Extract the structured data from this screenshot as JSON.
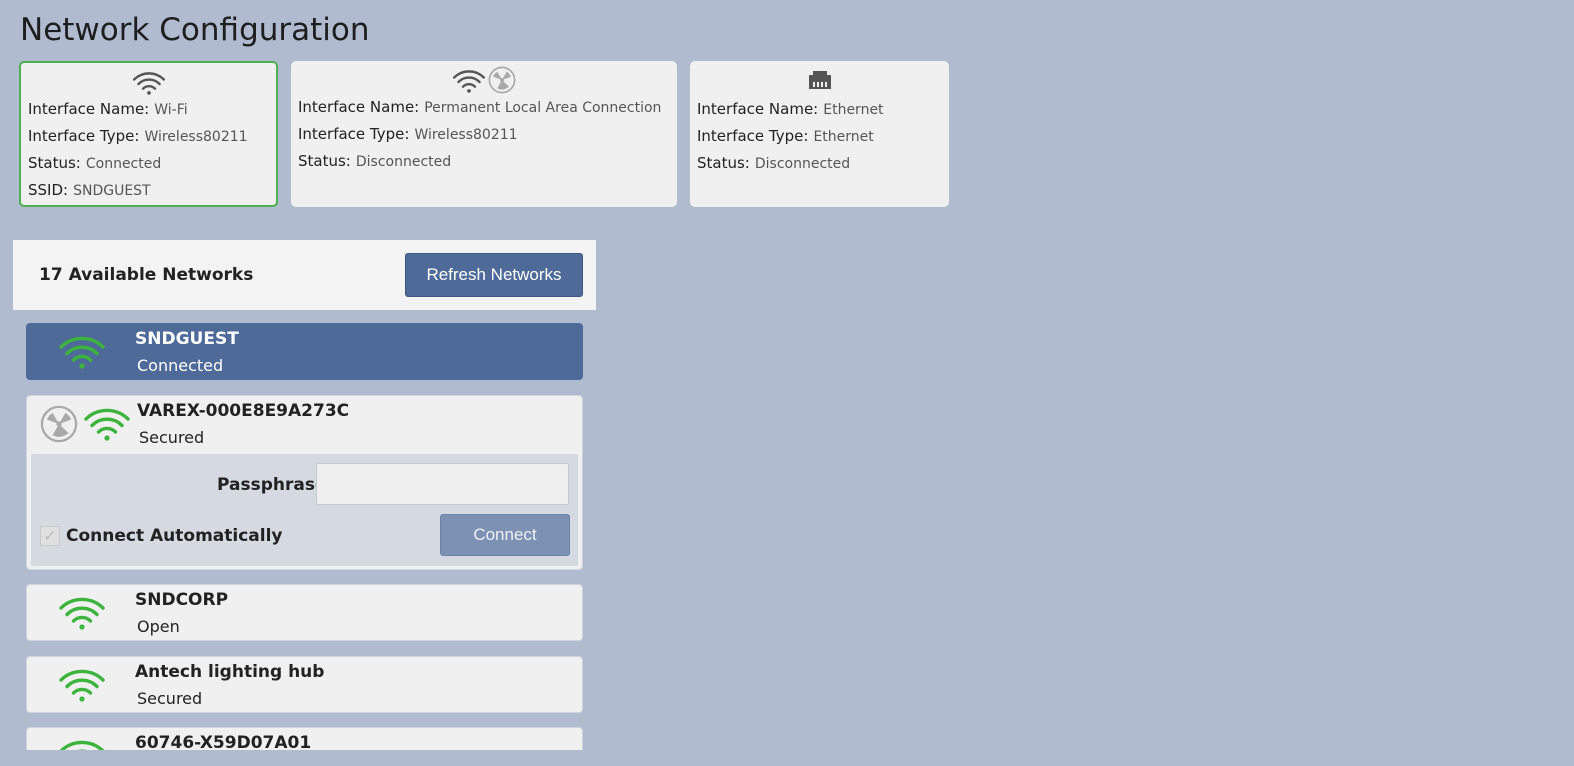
{
  "page": {
    "title": "Network Configuration"
  },
  "interfaces": [
    {
      "name_label": "Interface Name:",
      "name": "Wi-Fi",
      "type_label": "Interface Type:",
      "type": "Wireless80211",
      "status_label": "Status:",
      "status": "Connected",
      "ssid_label": "SSID:",
      "ssid": "SNDGUEST",
      "icons": [
        "wifi-icon"
      ],
      "selected": true
    },
    {
      "name_label": "Interface Name:",
      "name": "Permanent Local Area Connection",
      "type_label": "Interface Type:",
      "type": "Wireless80211",
      "status_label": "Status:",
      "status": "Disconnected",
      "icons": [
        "wifi-icon",
        "radioactive-icon"
      ]
    },
    {
      "name_label": "Interface Name:",
      "name": "Ethernet",
      "type_label": "Interface Type:",
      "type": "Ethernet",
      "status_label": "Status:",
      "status": "Disconnected",
      "icons": [
        "ethernet-icon"
      ]
    }
  ],
  "networks_panel": {
    "count_label": "17 Available Networks",
    "refresh_label": "Refresh Networks"
  },
  "networks": [
    {
      "ssid": "SNDGUEST",
      "status": "Connected"
    },
    {
      "ssid": "VAREX-000E8E9A273C",
      "status": "Secured",
      "expanded": true
    },
    {
      "ssid": "SNDCORP",
      "status": "Open"
    },
    {
      "ssid": "Antech lighting hub",
      "status": "Secured"
    },
    {
      "ssid": "60746-X59D07A01",
      "status": ""
    }
  ],
  "connect_form": {
    "passphrase_label": "Passphrase",
    "passphrase_value": "",
    "auto_label": "Connect Automatically",
    "auto_checked": true,
    "connect_label": "Connect"
  },
  "colors": {
    "background": "#b1bbd0",
    "accent": "#4d6a98",
    "connected_border": "#4caf50",
    "wifi_signal": "#3db43d"
  }
}
